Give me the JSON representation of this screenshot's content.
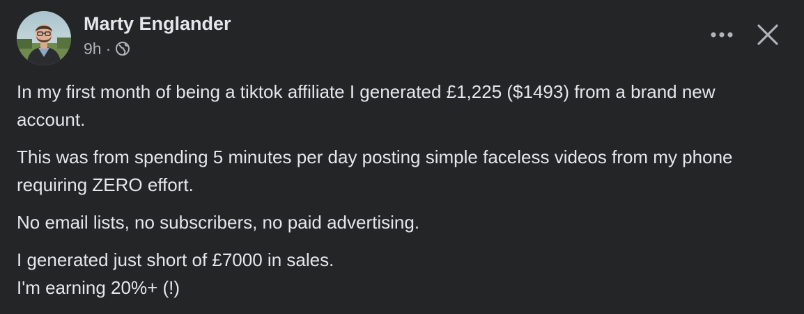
{
  "post": {
    "author": "Marty Englander",
    "timestamp": "9h",
    "separator": "·",
    "privacy_icon": "globe-icon",
    "more_icon": "more-horizontal-icon",
    "close_icon": "close-icon",
    "paragraphs": [
      "In my first month of being a tiktok affiliate I generated £1,225 ($1493) from a brand new account.",
      "This was from spending 5 minutes per day posting simple faceless videos from my phone requiring ZERO effort.",
      "No email lists, no subscribers, no paid advertising.",
      "I generated just short of £7000 in sales.\nI'm earning 20%+ (!)"
    ]
  },
  "colors": {
    "background": "#242526",
    "primary_text": "#e4e6eb",
    "secondary_text": "#b0b3b8"
  }
}
